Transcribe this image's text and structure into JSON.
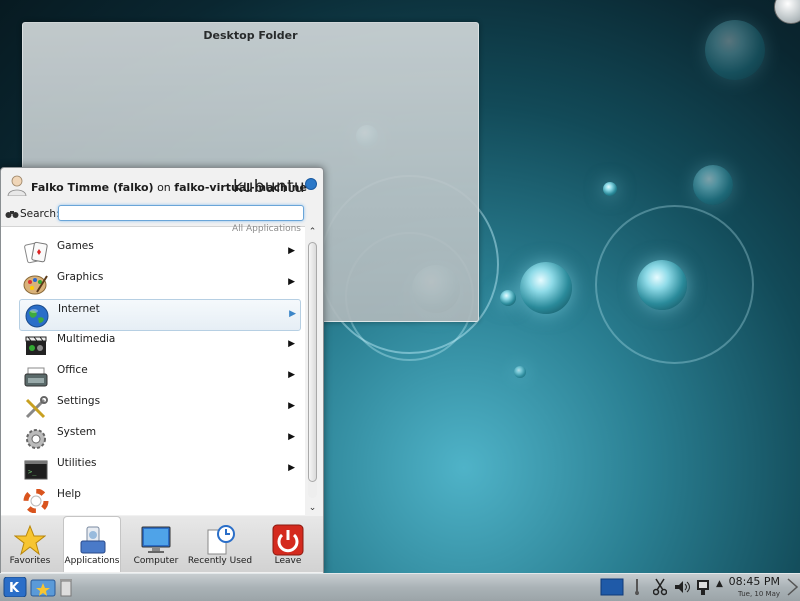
{
  "desktop": {
    "folder_title": "Desktop Folder"
  },
  "kickoff": {
    "user_name": "Falko Timme (falko)",
    "on_word": "on",
    "host": "falko-virtual-machine",
    "logo_text": "kubuntu",
    "search_label": "Search:",
    "search_value": "",
    "breadcrumb": "All Applications",
    "items": [
      {
        "label": "Games",
        "icon": "games-icon"
      },
      {
        "label": "Graphics",
        "icon": "graphics-icon"
      },
      {
        "label": "Internet",
        "icon": "globe-icon",
        "selected": true
      },
      {
        "label": "Multimedia",
        "icon": "multimedia-icon"
      },
      {
        "label": "Office",
        "icon": "typewriter-icon"
      },
      {
        "label": "Settings",
        "icon": "tools-icon"
      },
      {
        "label": "System",
        "icon": "gear-icon"
      },
      {
        "label": "Utilities",
        "icon": "terminal-icon"
      },
      {
        "label": "Help",
        "icon": "lifebuoy-icon",
        "has_arrow": false
      }
    ],
    "tabs": [
      {
        "label": "Favorites",
        "icon": "star-icon"
      },
      {
        "label": "Applications",
        "icon": "applications-icon",
        "active": true
      },
      {
        "label": "Computer",
        "icon": "monitor-icon"
      },
      {
        "label": "Recently Used",
        "icon": "clock-document-icon"
      },
      {
        "label": "Leave",
        "icon": "power-icon"
      }
    ]
  },
  "taskbar": {
    "clock_time": "08:45 PM",
    "clock_date": "Tue, 10 May"
  }
}
